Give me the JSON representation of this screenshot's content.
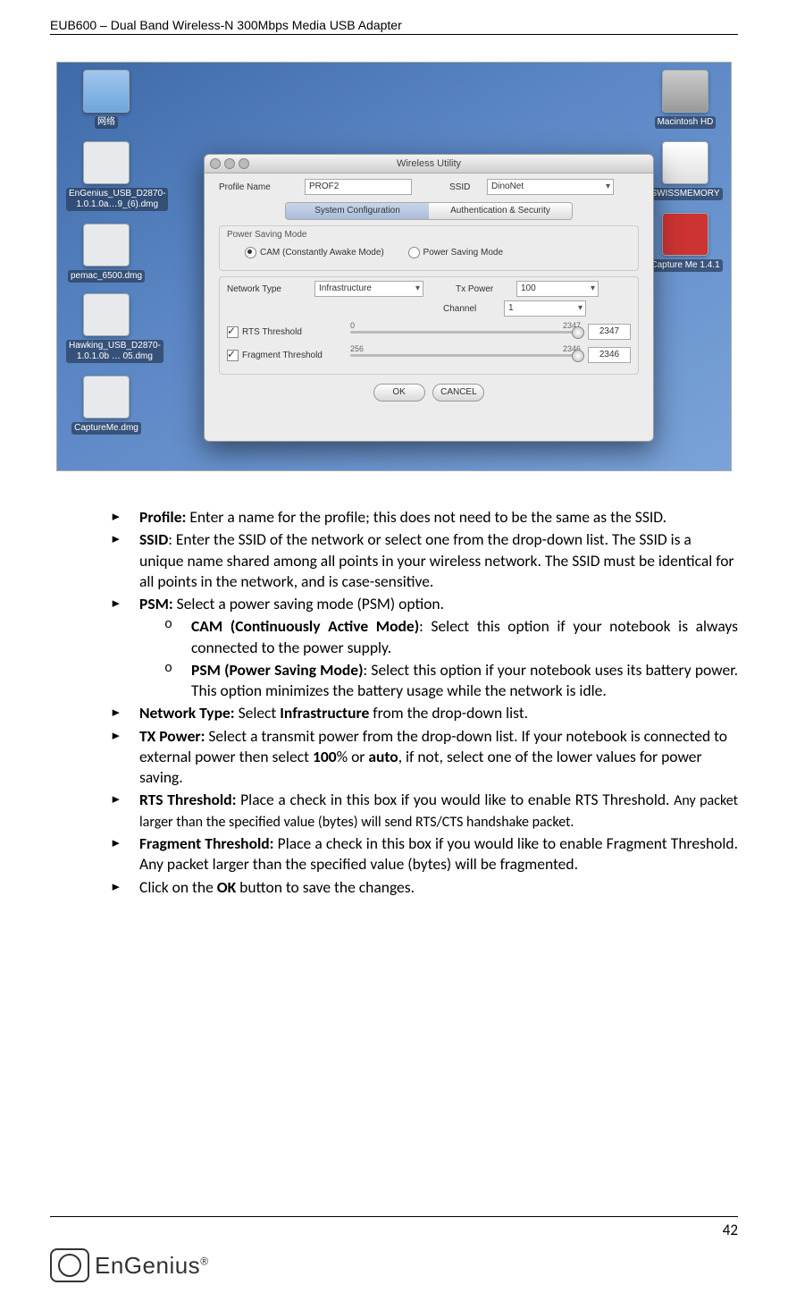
{
  "header": {
    "title": "EUB600 – Dual Band Wireless-N 300Mbps Media USB Adapter"
  },
  "footer": {
    "page_no": "42",
    "brand": "EnGenius",
    "brand_sup": "®"
  },
  "desktop": {
    "left_icons": [
      {
        "label": "网络"
      },
      {
        "label": "EnGenius_USB_D2870-1.0.1.0a…9_(6).dmg"
      },
      {
        "label": "pemac_6500.dmg"
      },
      {
        "label": "Hawking_USB_D2870-1.0.1.0b … 05.dmg"
      },
      {
        "label": "CaptureMe.dmg"
      }
    ],
    "right_icons": [
      {
        "label": "Macintosh HD"
      },
      {
        "label": "SWISSMEMORY"
      },
      {
        "label": "Capture Me 1.4.1"
      }
    ]
  },
  "window": {
    "title": "Wireless Utility",
    "profile_label": "Profile Name",
    "profile_value": "PROF2",
    "ssid_label": "SSID",
    "ssid_value": "DinoNet",
    "tab_syscfg": "System Configuration",
    "tab_auth": "Authentication & Security",
    "psm_group": "Power Saving Mode",
    "psm_cam": "CAM (Constantly Awake Mode)",
    "psm_psm": "Power Saving Mode",
    "nettype_label": "Network Type",
    "nettype_value": "Infrastructure",
    "txpower_label": "Tx Power",
    "txpower_value": "100",
    "channel_label": "Channel",
    "channel_value": "1",
    "rts_chk": "RTS Threshold",
    "rts_min": "0",
    "rts_max": "2347",
    "rts_val": "2347",
    "frag_chk": "Fragment Threshold",
    "frag_min": "256",
    "frag_max": "2346",
    "frag_val": "2346",
    "ok": "OK",
    "cancel": "CANCEL"
  },
  "doc": {
    "items": [
      {
        "b": "Profile:",
        "t": " Enter a name for the profile; this does not need to be the same as the SSID."
      },
      {
        "b": "SSID",
        "t": ": Enter the SSID of the network or select one from the drop-down list. The SSID is a unique name shared among all points in your wireless network. The SSID must be identical for all points in the network, and is case-sensitive."
      },
      {
        "b": "PSM:",
        "t": " Select a power saving mode (PSM) option."
      },
      {
        "b": "Network Type:",
        "t": " Select ",
        "b2": "Infrastructure",
        "t2": " from the drop-down list."
      },
      {
        "b": "TX Power:",
        "t": " Select a transmit power from the drop-down list. If your notebook is connected to external power then select ",
        "b2": "100",
        "t2": "% or ",
        "b3": "auto",
        "t3": ", if not, select one of the lower values for power saving."
      },
      {
        "b": "RTS Threshold:",
        "t": " Place a check in this box if you would like to enable RTS Threshold. ",
        "note": "Any packet larger than the specified value (bytes) will send RTS/CTS handshake packet."
      },
      {
        "b": "Fragment Threshold:",
        "t": " Place a check in this box if you would like to enable Fragment Threshold. Any packet larger than the specified value (bytes) will be fragmented."
      },
      {
        "plain1": "Click on the ",
        "b": "OK",
        "plain2": " button to save the changes."
      }
    ],
    "psm_sub": [
      {
        "b": "CAM (Continuously Active Mode)",
        "t": ": Select this option if your notebook is always connected to the power supply."
      },
      {
        "b": "PSM (Power Saving Mode)",
        "t": ": Select this option if your notebook uses its battery power. This option minimizes the battery usage while the network is idle."
      }
    ]
  }
}
